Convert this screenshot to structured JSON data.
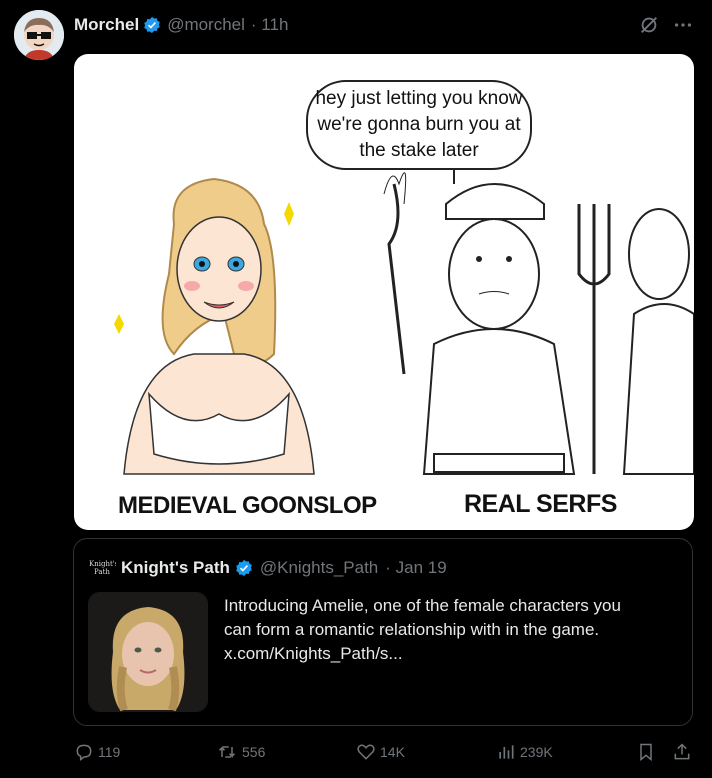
{
  "post": {
    "author_name": "Morchel",
    "author_handle": "@morchel",
    "time": "· 11h"
  },
  "meme": {
    "speech": [
      "hey just letting you know",
      "we're gonna burn you at",
      "the stake later"
    ],
    "left_caption": "MEDIEVAL GOONSLOP",
    "right_caption": "REAL SERFS"
  },
  "quote": {
    "logo_text": "Knight's Path",
    "name": "Knight's Path",
    "handle": "@Knights_Path",
    "date": "· Jan 19",
    "lines": [
      "Introducing Amelie, one of the female characters you",
      "can form a romantic relationship with in the game.",
      "x.com/Knights_Path/s..."
    ]
  },
  "actions": {
    "replies": "119",
    "reposts": "556",
    "likes": "14K",
    "views": "239K"
  },
  "colors": {
    "verified": "#1d9bf0",
    "muted": "#71767b",
    "border": "#2f3336"
  }
}
